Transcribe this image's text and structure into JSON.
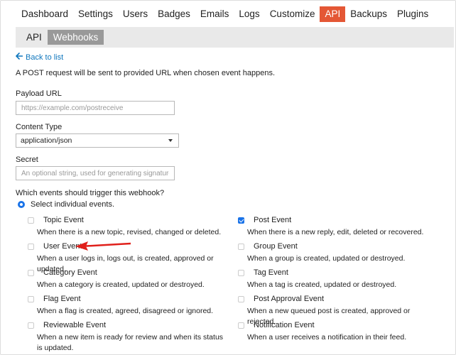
{
  "top_nav": {
    "items": [
      {
        "label": "Dashboard",
        "active": false
      },
      {
        "label": "Settings",
        "active": false
      },
      {
        "label": "Users",
        "active": false
      },
      {
        "label": "Badges",
        "active": false
      },
      {
        "label": "Emails",
        "active": false
      },
      {
        "label": "Logs",
        "active": false
      },
      {
        "label": "Customize",
        "active": false
      },
      {
        "label": "API",
        "active": true
      },
      {
        "label": "Backups",
        "active": false
      },
      {
        "label": "Plugins",
        "active": false
      }
    ],
    "active_color": "#e45735"
  },
  "sub_nav": {
    "items": [
      {
        "label": "API",
        "active": false
      },
      {
        "label": "Webhooks",
        "active": true
      }
    ]
  },
  "back_link": {
    "icon": "arrow-left-icon",
    "label": "Back to list"
  },
  "intro": "A POST request will be sent to provided URL when chosen event happens.",
  "form": {
    "payload_url": {
      "label": "Payload URL",
      "placeholder": "https://example.com/postreceive",
      "value": ""
    },
    "content_type": {
      "label": "Content Type",
      "value": "application/json"
    },
    "secret": {
      "label": "Secret",
      "placeholder": "An optional string, used for generating signature",
      "value": ""
    }
  },
  "trigger": {
    "question": "Which events should trigger this webhook?",
    "option_label": "Select individual events.",
    "option_selected": true
  },
  "events": [
    {
      "name": "Topic Event",
      "description": "When there is a new topic, revised, changed or deleted.",
      "checked": false
    },
    {
      "name": "Post Event",
      "description": "When there is a new reply, edit, deleted or recovered.",
      "checked": true
    },
    {
      "name": "User Event",
      "description": "When a user logs in, logs out, is created, approved or updated.",
      "checked": false
    },
    {
      "name": "Group Event",
      "description": "When a group is created, updated or destroyed.",
      "checked": false
    },
    {
      "name": "Category Event",
      "description": "When a category is created, updated or destroyed.",
      "checked": false
    },
    {
      "name": "Tag Event",
      "description": "When a tag is created, updated or destroyed.",
      "checked": false
    },
    {
      "name": "Flag Event",
      "description": "When a flag is created, agreed, disagreed or ignored.",
      "checked": false
    },
    {
      "name": "Post Approval Event",
      "description": "When a new queued post is created, approved or rejected.",
      "checked": false
    },
    {
      "name": "Reviewable Event",
      "description": "When a new item is ready for review and when its status is updated.",
      "checked": false
    },
    {
      "name": "Notification Event",
      "description": "When a user receives a notification in their feed.",
      "checked": false
    }
  ],
  "annotation": {
    "icon": "red-arrow-icon",
    "color": "#e0201b"
  },
  "accent_color": "#1a73e8",
  "link_color": "#0e76bd"
}
